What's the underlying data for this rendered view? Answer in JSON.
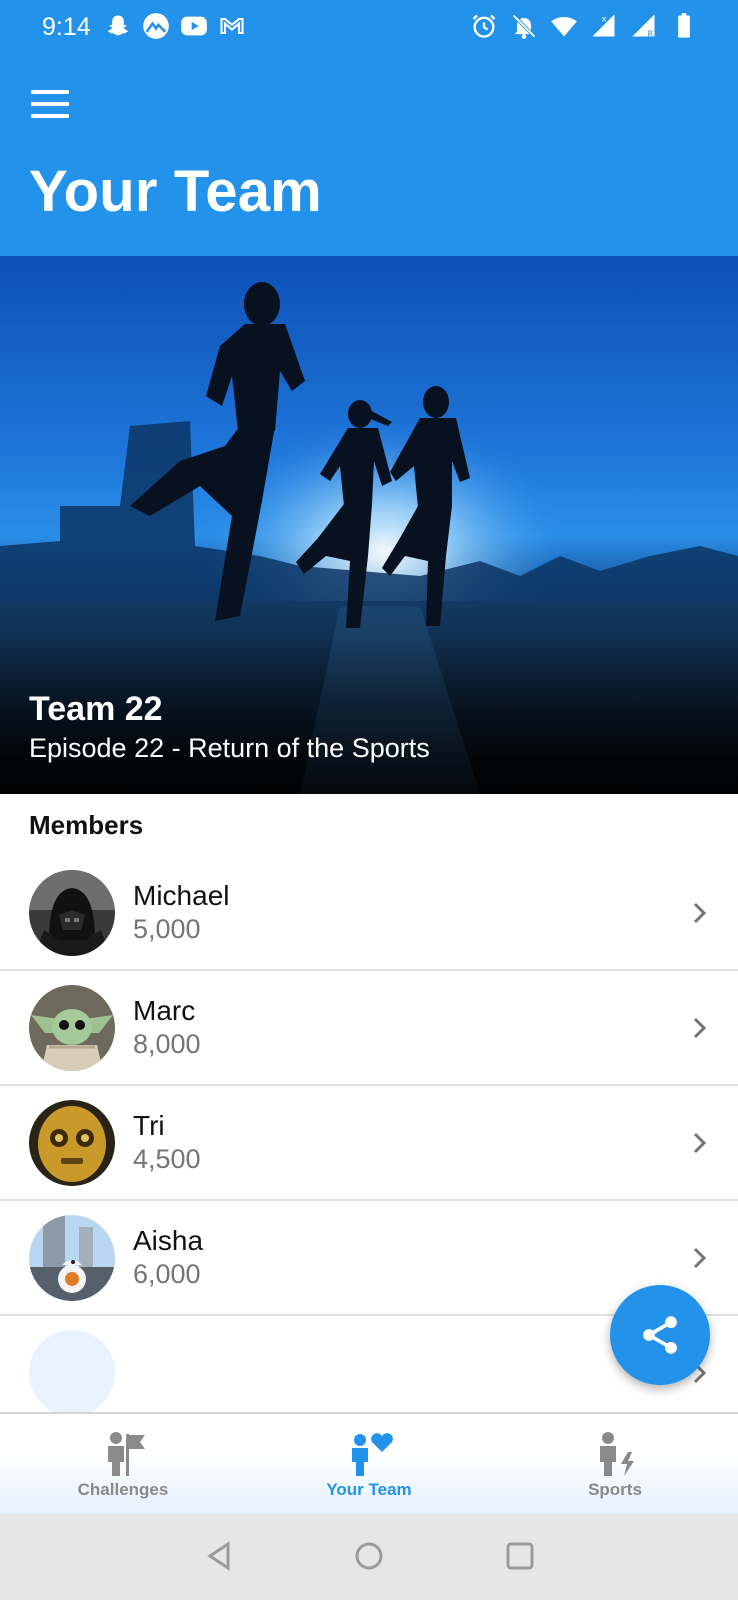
{
  "status_bar": {
    "time": "9:14",
    "left_icons": [
      "snapchat-icon",
      "mountain-app-icon",
      "youtube-icon",
      "gmail-icon"
    ],
    "right_icons": [
      "alarm-icon",
      "notifications-off-icon",
      "wifi-icon",
      "signal-icon",
      "signal-roaming-icon",
      "battery-icon"
    ]
  },
  "app_bar": {
    "menu_icon": "hamburger-menu-icon",
    "title": "Your Team"
  },
  "hero": {
    "team_name": "Team 22",
    "subtitle": "Episode 22 - Return of the Sports"
  },
  "members": {
    "heading": "Members",
    "items": [
      {
        "name": "Michael",
        "score": "5,000",
        "avatar": "darth-vader-avatar"
      },
      {
        "name": "Marc",
        "score": "8,000",
        "avatar": "baby-yoda-avatar"
      },
      {
        "name": "Tri",
        "score": "4,500",
        "avatar": "c3po-avatar"
      },
      {
        "name": "Aisha",
        "score": "6,000",
        "avatar": "bb8-avatar"
      },
      {
        "name": "",
        "score": "",
        "avatar": "placeholder-avatar"
      }
    ]
  },
  "fab": {
    "icon": "share-icon"
  },
  "bottom_nav": {
    "items": [
      {
        "label": "Challenges",
        "icon": "person-flag-icon",
        "active": false
      },
      {
        "label": "Your Team",
        "icon": "person-heart-icon",
        "active": true
      },
      {
        "label": "Sports",
        "icon": "person-bolt-icon",
        "active": false
      }
    ]
  },
  "system_nav": [
    "back-icon",
    "home-icon",
    "recents-icon"
  ],
  "colors": {
    "primary": "#2292ea",
    "text_secondary": "#757575",
    "inactive_nav": "#8a8a8a"
  }
}
